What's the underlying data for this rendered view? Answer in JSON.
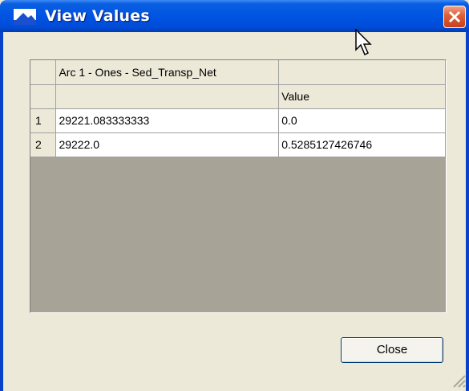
{
  "window": {
    "title": "View Values"
  },
  "table": {
    "header_row_1": [
      "",
      "Arc 1 - Ones - Sed_Transp_Net",
      ""
    ],
    "header_row_2": [
      "",
      "",
      "Value"
    ],
    "rows": [
      [
        "1",
        "29221.083333333",
        "0.0"
      ],
      [
        "2",
        "29222.0",
        "0.5285127426746"
      ]
    ]
  },
  "buttons": {
    "close_label": "Close"
  },
  "icons": [
    "window-app-icon",
    "close-window-icon",
    "mouse-cursor-icon",
    "resize-grip-icon"
  ],
  "colors": {
    "titlebar": "#0054e3",
    "window_bg": "#ece9d8",
    "grid_empty": "#a7a396",
    "close_x": "#e0623a"
  }
}
